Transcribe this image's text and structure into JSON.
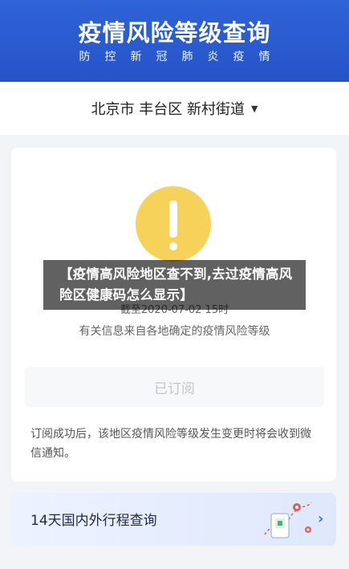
{
  "header": {
    "title": "疫情风险等级查询",
    "subtitle": "防控新冠肺炎疫情"
  },
  "location": {
    "text": "北京市 丰台区 新村街道"
  },
  "status": {
    "overlay_title": "【疫情高风险地区查不到,去过疫情高风险区健康码怎么显示】",
    "deadline": "截至2020-07-02 15时",
    "source": "有关信息来自各地确定的疫情风险等级",
    "subscribe_label": "已订阅",
    "notice": "订阅成功后，该地区疫情风险等级发生变更时将会收到微信通知。"
  },
  "itinerary": {
    "label": "14天国内外行程查询"
  },
  "colors": {
    "header_blue": "#2a5bd7",
    "warning_yellow": "#f6d25b"
  },
  "icons": {
    "warning": "exclamation-icon",
    "dropdown": "caret-down-icon",
    "chevron": "chevron-right-icon"
  }
}
